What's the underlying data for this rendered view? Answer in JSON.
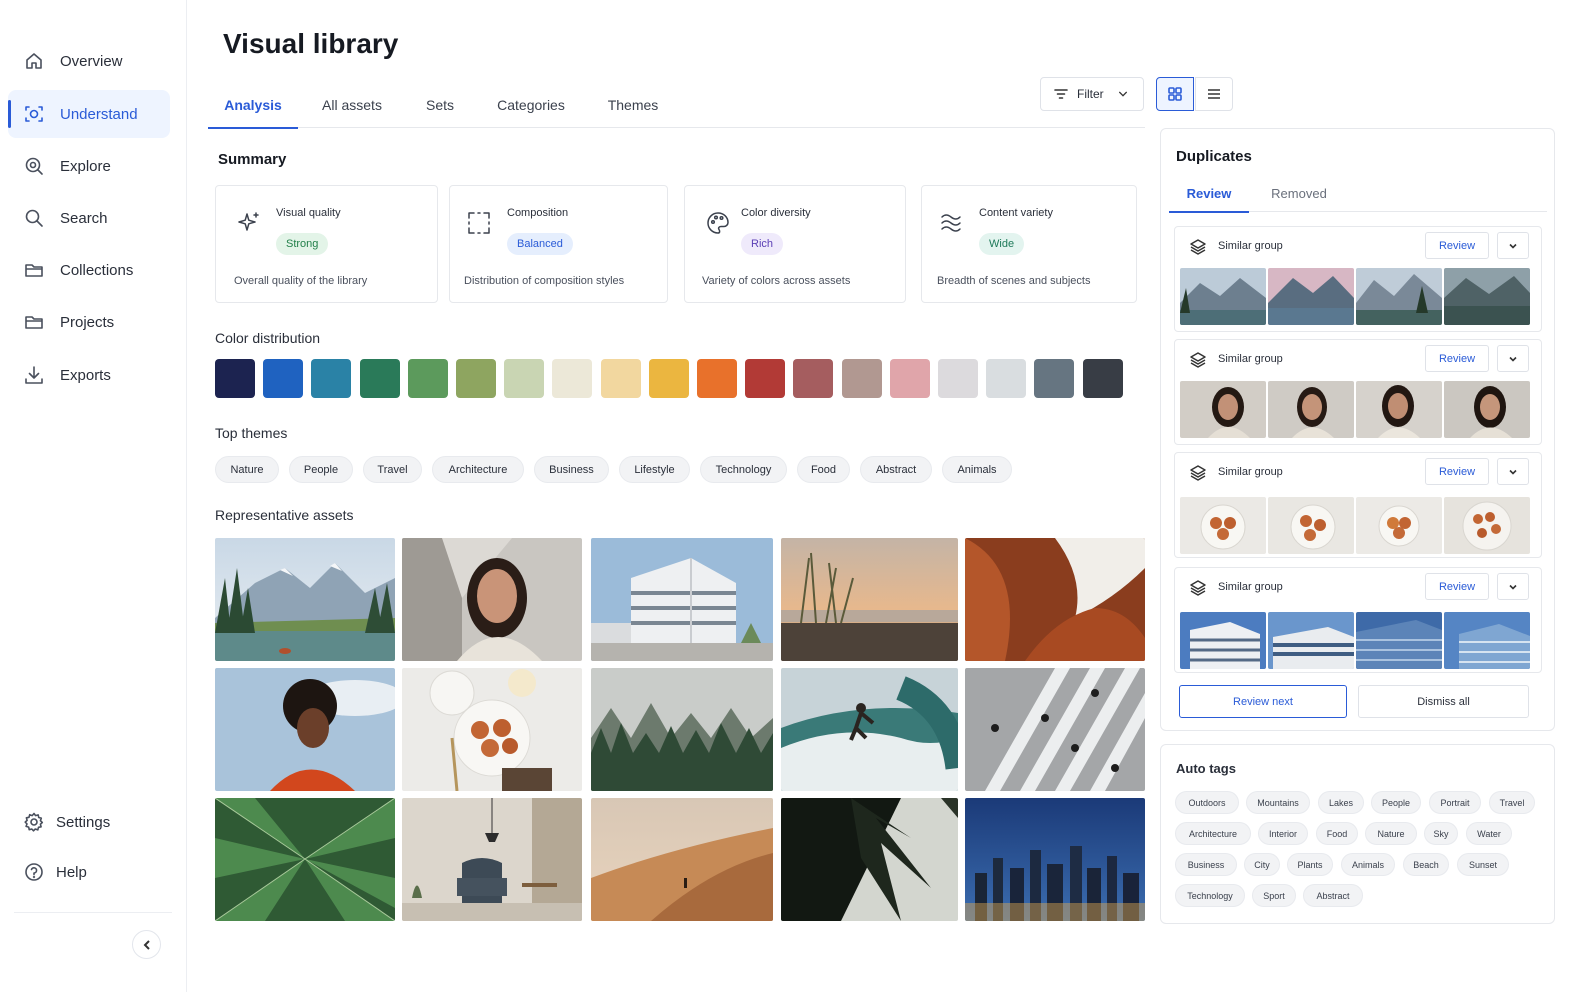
{
  "sidebar": {
    "items": [
      {
        "label": "Overview",
        "icon": "home-icon"
      },
      {
        "label": "Understand",
        "icon": "scan-icon",
        "active": true
      },
      {
        "label": "Explore",
        "icon": "explore-icon"
      },
      {
        "label": "Search",
        "icon": "search-icon"
      },
      {
        "label": "Collections",
        "icon": "folder-icon"
      },
      {
        "label": "Projects",
        "icon": "folder-icon"
      },
      {
        "label": "Exports",
        "icon": "download-icon"
      }
    ],
    "bottom": [
      {
        "label": "Settings",
        "icon": "gear-icon"
      },
      {
        "label": "Help",
        "icon": "help-icon"
      }
    ]
  },
  "header": {
    "title": "Visual library",
    "tabs": [
      "Analysis",
      "All assets",
      "Sets",
      "Categories",
      "Themes"
    ],
    "active_tab": "Analysis",
    "filter_label": "Filter"
  },
  "summary": {
    "title": "Summary",
    "cards": [
      {
        "label": "Visual quality",
        "badge": "Strong",
        "desc": "Overall quality of the library",
        "icon": "sparkle-icon",
        "badge_color": "#e3f4e8",
        "badge_text": "#23804a"
      },
      {
        "label": "Composition",
        "badge": "Balanced",
        "desc": "Distribution of composition styles",
        "icon": "frame-icon",
        "badge_color": "#e5eefd",
        "badge_text": "#2a5bd7"
      },
      {
        "label": "Color diversity",
        "badge": "Rich",
        "desc": "Variety of colors across assets",
        "icon": "palette-icon",
        "badge_color": "#efeafb",
        "badge_text": "#5b3fb5"
      },
      {
        "label": "Content variety",
        "badge": "Wide",
        "desc": "Breadth of scenes and subjects",
        "icon": "variety-icon",
        "badge_color": "#e3f4ef",
        "badge_text": "#1f7a5a"
      }
    ]
  },
  "color_distribution": {
    "title": "Color distribution",
    "colors": [
      "#1c2350",
      "#1f62c0",
      "#2a82a6",
      "#2a7a59",
      "#5c9a5c",
      "#8ea560",
      "#c9d5b3",
      "#ece8d8",
      "#f2d79f",
      "#ebb640",
      "#e8712b",
      "#b23a36",
      "#a55d5f",
      "#b19891",
      "#e0a5aa",
      "#dcdadd",
      "#d9dde0",
      "#667581",
      "#383d45"
    ]
  },
  "top_themes": {
    "title": "Top themes",
    "items": [
      "Nature",
      "People",
      "Travel",
      "Architecture",
      "Business",
      "Lifestyle",
      "Technology",
      "Food",
      "Abstract",
      "Animals"
    ]
  },
  "representative_assets": {
    "title": "Representative assets",
    "images": [
      "mountain-lake",
      "woman-portrait",
      "modern-building",
      "beach-sunset",
      "red-rock-canyon",
      "woman-sky",
      "food-plate",
      "misty-forest",
      "surfer-wave",
      "crosswalk-aerial",
      "green-leaf",
      "interior-chair",
      "desert-dune",
      "palm-shadow",
      "city-night"
    ]
  },
  "duplicates": {
    "title": "Duplicates",
    "tabs": [
      "Review",
      "Removed"
    ],
    "active_tab": "Review",
    "groups": [
      {
        "label": "Similar group",
        "review_label": "Review",
        "theme": "mountain-lake"
      },
      {
        "label": "Similar group",
        "review_label": "Review",
        "theme": "woman-portrait"
      },
      {
        "label": "Similar group",
        "review_label": "Review",
        "theme": "food-plate"
      },
      {
        "label": "Similar group",
        "review_label": "Review",
        "theme": "modern-building"
      }
    ],
    "review_next_label": "Review next",
    "dismiss_all_label": "Dismiss all"
  },
  "auto_tags": {
    "title": "Auto tags",
    "rows": [
      [
        "Outdoors",
        "Mountains",
        "Lakes",
        "People",
        "Portrait",
        "Travel"
      ],
      [
        "Architecture",
        "Interior",
        "Food",
        "Nature",
        "Sky",
        "Water"
      ],
      [
        "Business",
        "City",
        "Plants",
        "Animals",
        "Beach",
        "Sunset"
      ],
      [
        "Technology",
        "Sport",
        "Abstract"
      ]
    ]
  }
}
